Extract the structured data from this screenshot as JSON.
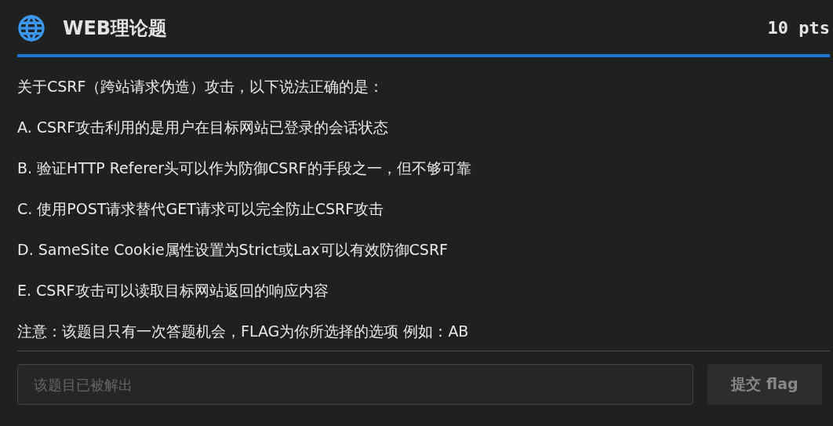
{
  "challenge": {
    "title": "WEB理论题",
    "points": "10 pts"
  },
  "question": "关于CSRF（跨站请求伪造）攻击，以下说法正确的是：",
  "options": [
    "A. CSRF攻击利用的是用户在目标网站已登录的会话状态",
    "B. 验证HTTP Referer头可以作为防御CSRF的手段之一，但不够可靠",
    "C. 使用POST请求替代GET请求可以完全防止CSRF攻击",
    "D. SameSite Cookie属性设置为Strict或Lax可以有效防御CSRF",
    "E. CSRF攻击可以读取目标网站返回的响应内容"
  ],
  "note": "注意：该题目只有一次答题机会，FLAG为你所选择的选项 例如：AB",
  "flag_field": {
    "placeholder": "该题目已被解出",
    "disabled": true
  },
  "submit_button": {
    "label": "提交 flag",
    "disabled": true
  }
}
